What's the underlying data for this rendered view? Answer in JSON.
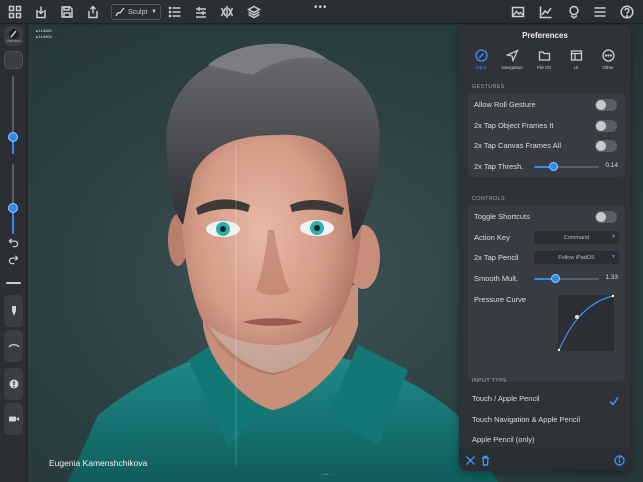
{
  "toolbar": {
    "tool_name": "Sculpt",
    "icons": [
      "grid-icon",
      "import-icon",
      "save-icon",
      "share-icon",
      "brush-icon",
      "list-icon",
      "layers-adjust-icon",
      "symmetry-x-icon",
      "layers-icon",
      "image-icon",
      "chart-icon",
      "material-icon",
      "menu-icon",
      "help-icon"
    ],
    "more_label": "•••"
  },
  "leftbar": {
    "top_tool_label": "Standard",
    "slider_size_level": 0.35,
    "slider_strength_level": 0.5
  },
  "viewport": {
    "stats": [
      "114282",
      "114004"
    ],
    "credit": "Eugenia Kamenshchikova",
    "bottom_handle": "─ •••• ─"
  },
  "preferences": {
    "title": "Preferences",
    "tabs": [
      {
        "label": "Input",
        "icon": "pencil-circle-icon",
        "active": true
      },
      {
        "label": "Navigation",
        "icon": "navigation-arrow-icon",
        "active": false
      },
      {
        "label": "File I/O",
        "icon": "folder-icon",
        "active": false
      },
      {
        "label": "UI",
        "icon": "window-icon",
        "active": false
      },
      {
        "label": "Other",
        "icon": "ellipsis-circle-icon",
        "active": false
      }
    ],
    "gestures": {
      "header": "GESTURES",
      "allow_roll": "Allow Roll Gesture",
      "tap_object": "2x Tap Object Frames It",
      "tap_canvas": "2x Tap Canvas Frames All",
      "tap_thresh": "2x Tap Thresh.",
      "tap_thresh_value": "0.14",
      "tap_thresh_level": 0.3
    },
    "controls": {
      "header": "CONTROLS",
      "toggle_shortcuts": "Toggle Shortcuts",
      "action_key": "Action Key",
      "action_key_value": "Command",
      "tap_pencil": "2x Tap Pencil",
      "tap_pencil_value": "Follow iPadOS",
      "smooth_mult": "Smooth Mult.",
      "smooth_mult_value": "1.33",
      "smooth_mult_level": 0.33,
      "pressure_curve": "Pressure Curve"
    },
    "input_type": {
      "header": "INPUT TYPE",
      "options": [
        "Touch / Apple Pencil",
        "Touch Navigation & Apple Pencil",
        "Apple Pencil (only)"
      ],
      "selected": "Touch / Apple Pencil"
    },
    "accent": "#3b93f5"
  }
}
